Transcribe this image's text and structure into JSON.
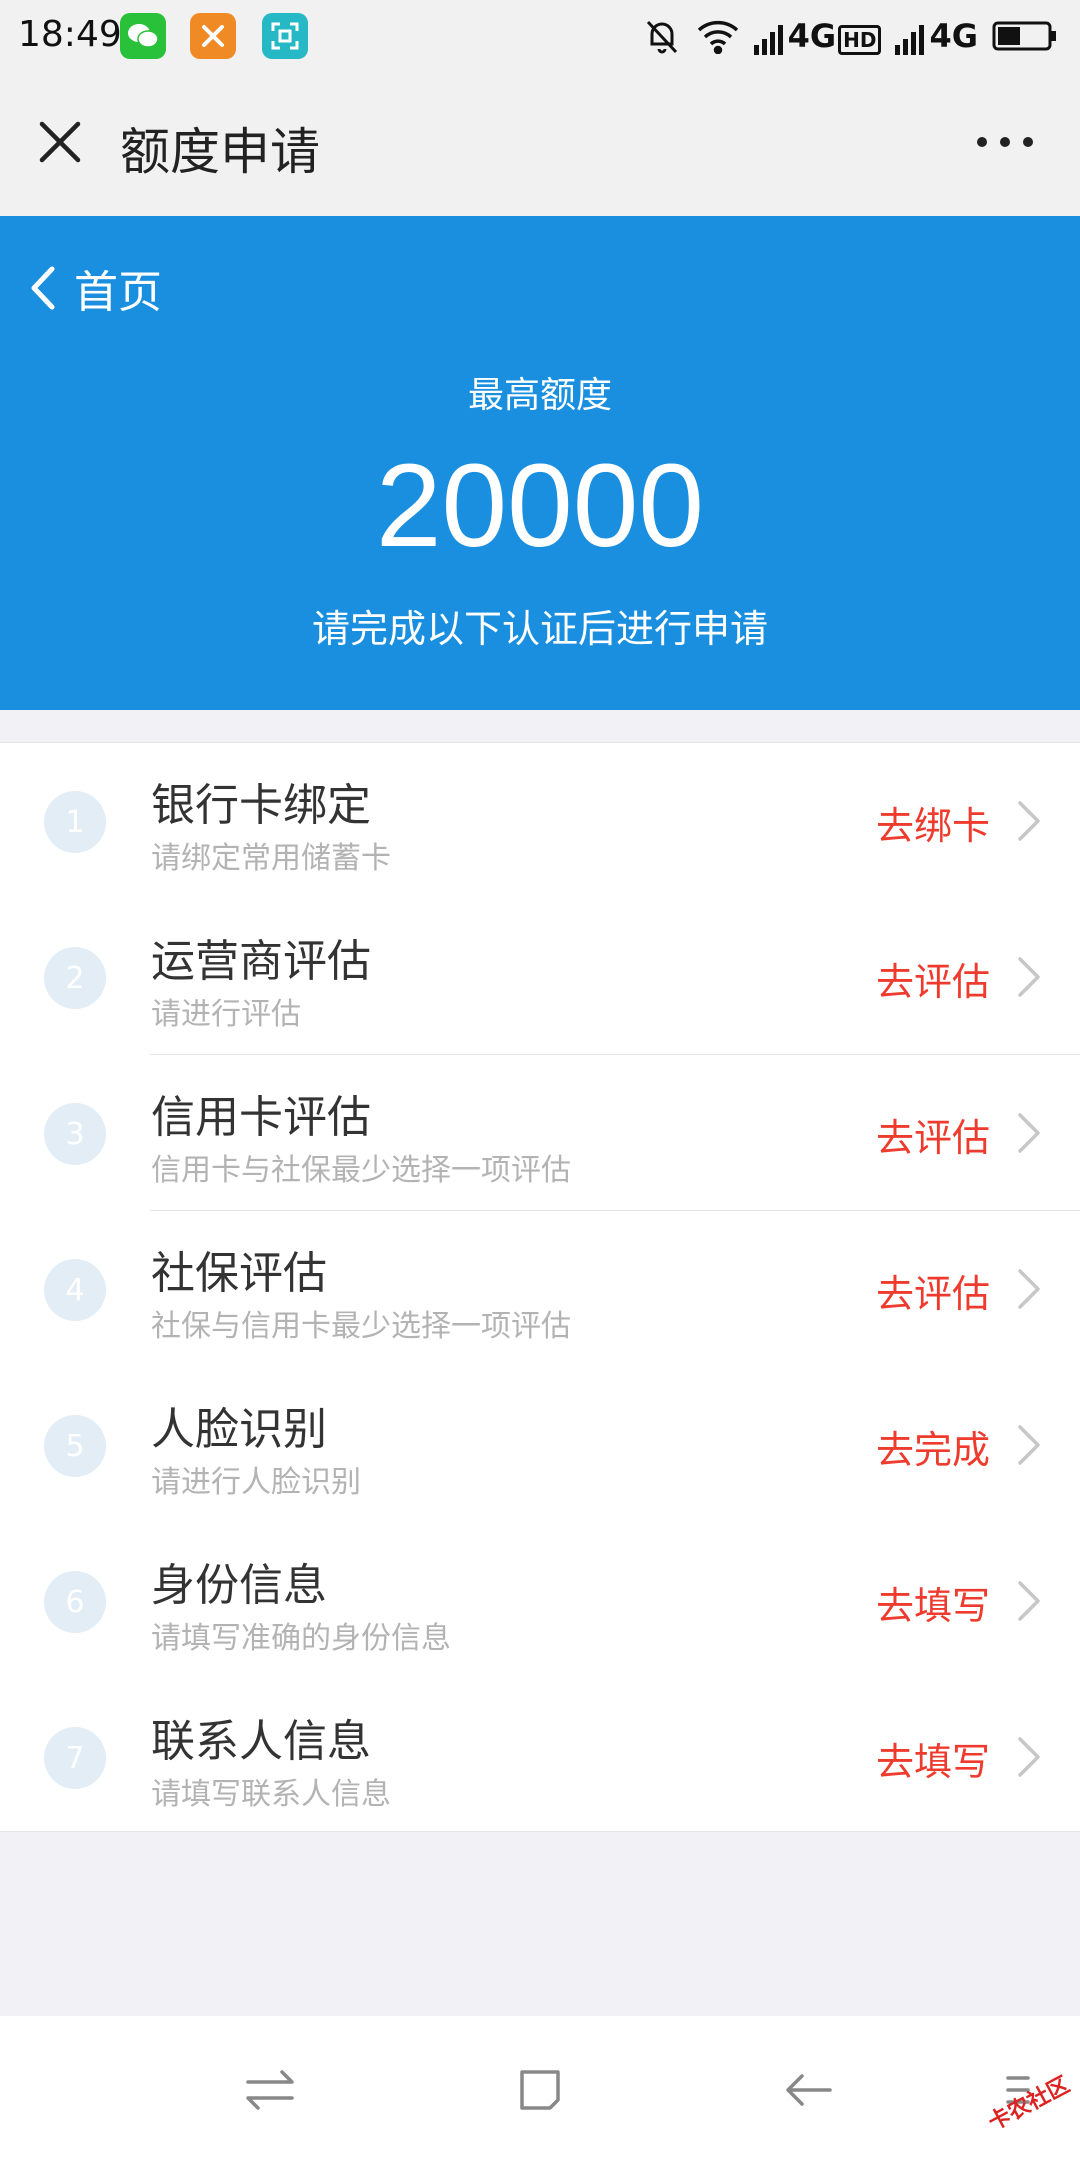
{
  "status_bar": {
    "time": "18:49",
    "network_1": "4G",
    "hd_badge": "HD",
    "network_2": "4G",
    "icons": [
      "wechat-icon",
      "app-x-icon",
      "scan-icon",
      "bell-off-icon",
      "wifi-icon",
      "signal-icon",
      "battery-icon"
    ]
  },
  "navbar": {
    "title": "额度申请"
  },
  "hero": {
    "back_label": "首页",
    "subtitle": "最高额度",
    "amount": "20000",
    "note": "请完成以下认证后进行申请",
    "color": "#1a8fe0"
  },
  "steps": [
    {
      "num": "1",
      "title": "银行卡绑定",
      "desc": "请绑定常用储蓄卡",
      "action": "去绑卡"
    },
    {
      "num": "2",
      "title": "运营商评估",
      "desc": "请进行评估",
      "action": "去评估"
    },
    {
      "num": "3",
      "title": "信用卡评估",
      "desc": "信用卡与社保最少选择一项评估",
      "action": "去评估"
    },
    {
      "num": "4",
      "title": "社保评估",
      "desc": "社保与信用卡最少选择一项评估",
      "action": "去评估"
    },
    {
      "num": "5",
      "title": "人脸识别",
      "desc": "请进行人脸识别",
      "action": "去完成"
    },
    {
      "num": "6",
      "title": "身份信息",
      "desc": "请填写准确的身份信息",
      "action": "去填写"
    },
    {
      "num": "7",
      "title": "联系人信息",
      "desc": "请填写联系人信息",
      "action": "去填写"
    }
  ],
  "action_color": "#ef3b2d",
  "watermark": "卡农社区"
}
